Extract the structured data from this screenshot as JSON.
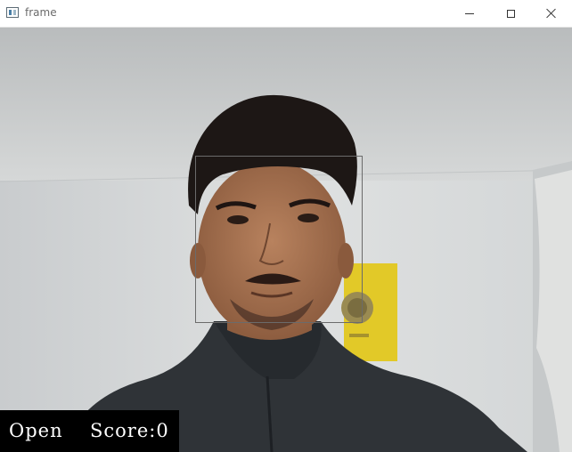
{
  "window": {
    "title": "frame",
    "icon": "window-app-icon",
    "controls": [
      "minimize-icon",
      "maximize-icon",
      "close-icon"
    ]
  },
  "overlay": {
    "status_text": "Open",
    "score_text": "Score:0"
  },
  "colors": {
    "hud_background": "#000000",
    "hud_text": "#ffffff",
    "face_box": "#6b6b6b"
  }
}
